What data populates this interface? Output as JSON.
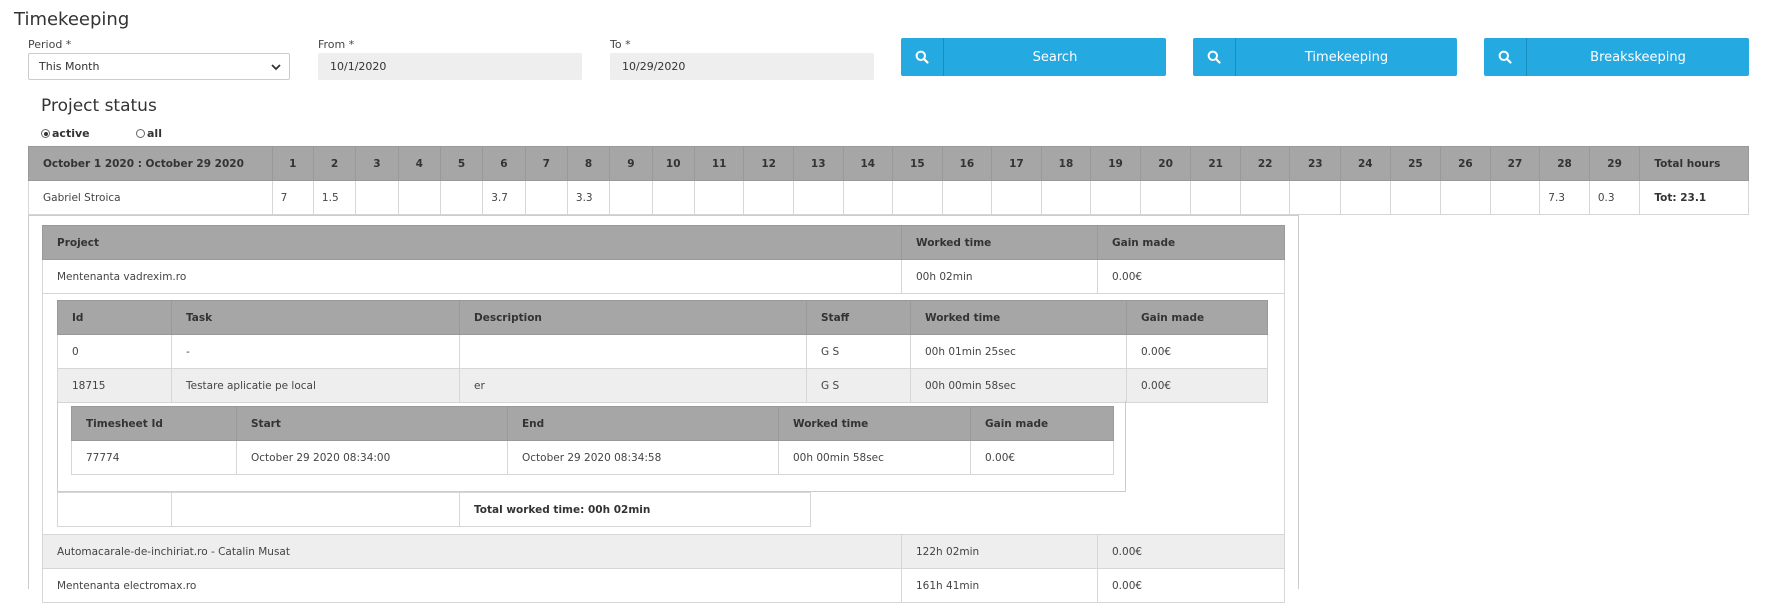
{
  "page": {
    "title": "Timekeeping"
  },
  "filters": {
    "period_label": "Period *",
    "period_value": "This Month",
    "from_label": "From *",
    "from_value": "10/1/2020",
    "to_label": "To *",
    "to_value": "10/29/2020"
  },
  "buttons": {
    "search": "Search",
    "timekeeping": "Timekeeping",
    "breakskeeping": "Breakskeeping"
  },
  "project_status": {
    "heading": "Project status",
    "radio_active": "active",
    "radio_all": "all",
    "selected": "active"
  },
  "summary": {
    "range_label": "October 1 2020 : October 29 2020",
    "days": [
      "1",
      "2",
      "3",
      "4",
      "5",
      "6",
      "7",
      "8",
      "9",
      "10",
      "11",
      "12",
      "13",
      "14",
      "15",
      "16",
      "17",
      "18",
      "19",
      "20",
      "21",
      "22",
      "23",
      "24",
      "25",
      "26",
      "27",
      "28",
      "29"
    ],
    "total_header": "Total hours",
    "row": {
      "name": "Gabriel Stroica",
      "values": [
        "7",
        "1.5",
        "",
        "",
        "",
        "3.7",
        "",
        "3.3",
        "",
        "",
        "",
        "",
        "",
        "",
        "",
        "",
        "",
        "",
        "",
        "",
        "",
        "",
        "",
        "",
        "",
        "",
        "",
        "7.3",
        "0.3"
      ],
      "total": "Tot: 23.1"
    }
  },
  "projects": {
    "headers": [
      "Project",
      "Worked time",
      "Gain made"
    ],
    "rows": [
      {
        "project": "Mentenanta vadrexim.ro",
        "worked": "00h 02min",
        "gain": "0.00€"
      },
      {
        "project": "Automacarale-de-inchiriat.ro - Catalin Musat",
        "worked": "122h 02min",
        "gain": "0.00€"
      },
      {
        "project": "Mentenanta electromax.ro",
        "worked": "161h 41min",
        "gain": "0.00€"
      }
    ]
  },
  "tasks": {
    "headers": [
      "Id",
      "Task",
      "Description",
      "Staff",
      "Worked time",
      "Gain made"
    ],
    "rows": [
      {
        "id": "0",
        "task": "-",
        "description": "",
        "staff": "G S",
        "worked": "00h 01min 25sec",
        "gain": "0.00€"
      },
      {
        "id": "18715",
        "task": "Testare aplicatie pe local",
        "description": "er",
        "staff": "G S",
        "worked": "00h 00min 58sec",
        "gain": "0.00€"
      }
    ],
    "total_label": "Total worked time: 00h 02min"
  },
  "timesheets": {
    "headers": [
      "Timesheet Id",
      "Start",
      "End",
      "Worked time",
      "Gain made"
    ],
    "rows": [
      {
        "id": "77774",
        "start": "October 29 2020 08:34:00",
        "end": "October 29 2020 08:34:58",
        "worked": "00h 00min 58sec",
        "gain": "0.00€"
      }
    ]
  },
  "colors": {
    "button": "#24a9e1",
    "header": "#a6a6a6",
    "alt_row": "#eeeeee"
  },
  "icons": {
    "button_icon": "search-icon",
    "select_icon": "chevron-down-icon"
  }
}
